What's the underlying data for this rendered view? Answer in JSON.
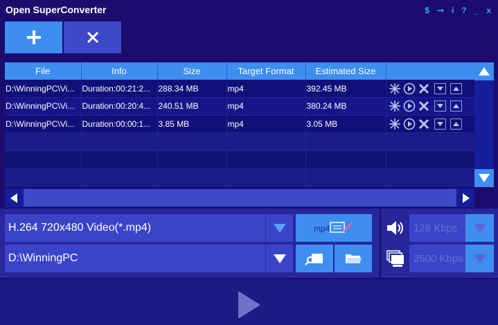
{
  "app": {
    "title": "Open SuperConverter"
  },
  "window_controls": [
    {
      "name": "buy-icon",
      "glyph": "$"
    },
    {
      "name": "key-icon",
      "glyph": "⊸"
    },
    {
      "name": "info-icon",
      "glyph": "i"
    },
    {
      "name": "help-icon",
      "glyph": "?"
    },
    {
      "name": "minimize-icon",
      "glyph": "_"
    },
    {
      "name": "close-icon",
      "glyph": "x"
    }
  ],
  "toolbar": {
    "add_icon": "plus-icon",
    "remove_icon": "x-icon"
  },
  "table": {
    "columns": [
      "File",
      "Info",
      "Size",
      "Target Format",
      "Estimated Size"
    ],
    "rows": [
      {
        "file": "D:\\WinningPC\\Vi...",
        "info": "Duration:00:21:2...",
        "size": "288.34 MB",
        "format": "mp4",
        "estimated": "392.45 MB"
      },
      {
        "file": "D:\\WinningPC\\Vi...",
        "info": "Duration:00:20:4...",
        "size": "240.51 MB",
        "format": "mp4",
        "estimated": "380.24 MB"
      },
      {
        "file": "D:\\WinningPC\\Vi...",
        "info": "Duration:00:00:1...",
        "size": "3.85 MB",
        "format": "mp4",
        "estimated": "3.05 MB"
      }
    ]
  },
  "output": {
    "format_value": "H.264 720x480 Video(*.mp4)",
    "folder_value": "D:\\WinningPC",
    "edit_label": "mp4",
    "audio_bitrate": "128 Kbps",
    "video_bitrate": "2500 Kbps"
  },
  "colors": {
    "background": "#1c0c6e",
    "accent": "#3d8ef0",
    "panel": "#27279b",
    "field": "#3a44c9"
  }
}
